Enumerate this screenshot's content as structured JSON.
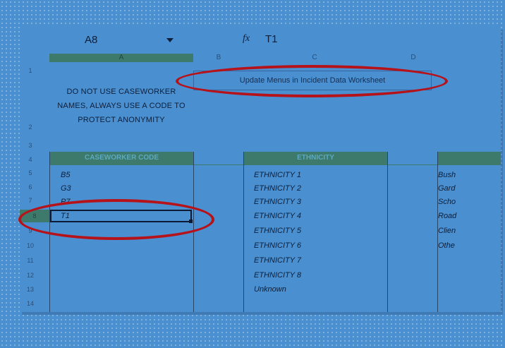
{
  "formula_bar": {
    "name_box": "A8",
    "fx_label": "fx",
    "formula_value": "T1"
  },
  "columns": [
    "A",
    "B",
    "C",
    "D"
  ],
  "rows": [
    "1",
    "2",
    "3",
    "4",
    "5",
    "6",
    "7",
    "8",
    "9",
    "10",
    "11",
    "12",
    "13",
    "14"
  ],
  "update_menus_button": "Update Menus in Incident Data Worksheet",
  "note_lines": [
    "DO NOT USE CASEWORKER",
    "NAMES, ALWAYS USE A CODE TO",
    "PROTECT ANONYMITY"
  ],
  "caseworker_table": {
    "header": "CASEWORKER CODE",
    "codes": [
      "B5",
      "G3",
      "P7",
      "T1"
    ]
  },
  "ethnicity_table": {
    "header": "ETHNICITY",
    "items": [
      "ETHNICITY 1",
      "ETHNICITY 2",
      "ETHNICITY 3",
      "ETHNICITY 4",
      "ETHNICITY 5",
      "ETHNICITY 6",
      "ETHNICITY 7",
      "ETHNICITY 8",
      "Unknown"
    ]
  },
  "location_items": [
    "Bush",
    "Gard",
    "Scho",
    "Road",
    "Clien",
    "Othe"
  ],
  "colors": {
    "background": "#4a8fd0",
    "header_fill": "#3e7a6c",
    "highlight": "#b6121a"
  }
}
